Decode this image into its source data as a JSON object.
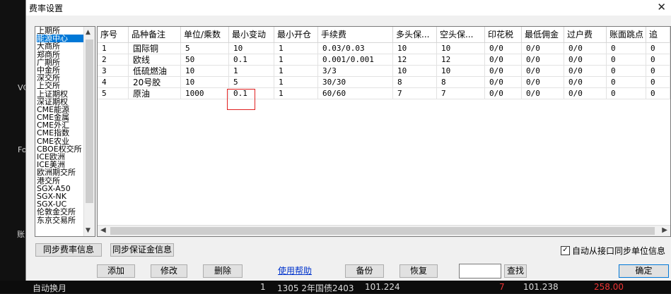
{
  "dialog": {
    "title": "费率设置",
    "close_glyph": "✕"
  },
  "background": {
    "left_texts": [
      "VC",
      "Fo",
      "账"
    ],
    "bottom_texts": [
      "自动换月",
      "1",
      "1305 2年国债2403",
      "101.224",
      "7",
      "101.238",
      "258.00"
    ]
  },
  "exchanges": [
    "上期所",
    "能源中心",
    "大商所",
    "郑商所",
    "广期所",
    "中金所",
    "深交所",
    "上交所",
    "上证期权",
    "深证期权",
    "CME能源",
    "CME金属",
    "CME外汇",
    "CME指数",
    "CME农业",
    "CBOE权交所",
    "ICE欧洲",
    "ICE美洲",
    "欧洲期交所",
    "港交所",
    "SGX-A50",
    "SGX-NK",
    "SGX-UC",
    "伦敦金交所",
    "东京交易所"
  ],
  "selected_exchange": "能源中心",
  "table": {
    "headers": [
      "序号",
      "品种备注",
      "单位/乘数",
      "最小变动",
      "最小开仓",
      "手续费",
      "多头保...",
      "空头保...",
      "印花税",
      "最低佣金",
      "过户费",
      "账面跳点",
      "追"
    ],
    "rows": [
      [
        "1",
        "国际铜",
        "5",
        "10",
        "1",
        "0.03/0.03",
        "10",
        "10",
        "0/0",
        "0/0",
        "0/0",
        "0",
        "0"
      ],
      [
        "2",
        "欧线",
        "50",
        "0.1",
        "1",
        "0.001/0.001",
        "12",
        "12",
        "0/0",
        "0/0",
        "0/0",
        "0",
        "0"
      ],
      [
        "3",
        "低硫燃油",
        "10",
        "1",
        "1",
        "3/3",
        "10",
        "10",
        "0/0",
        "0/0",
        "0/0",
        "0",
        "0"
      ],
      [
        "4",
        "20号胶",
        "10",
        "5",
        "1",
        "30/30",
        "8",
        "8",
        "0/0",
        "0/0",
        "0/0",
        "0",
        "0"
      ],
      [
        "5",
        "原油",
        "1000",
        "0.1",
        "1",
        "60/60",
        "7",
        "7",
        "0/0",
        "0/0",
        "0/0",
        "0",
        "0"
      ]
    ]
  },
  "buttons": {
    "sync_rate": "同步费率信息",
    "sync_margin": "同步保证金信息",
    "add": "添加",
    "modify": "修改",
    "delete": "删除",
    "help": "使用帮助",
    "backup": "备份",
    "restore": "恢复",
    "search": "查找",
    "ok": "确定"
  },
  "auto_sync": {
    "label": "自动从接口同步单位信息",
    "checked": true,
    "check_glyph": "✓"
  },
  "search": {
    "value": ""
  }
}
